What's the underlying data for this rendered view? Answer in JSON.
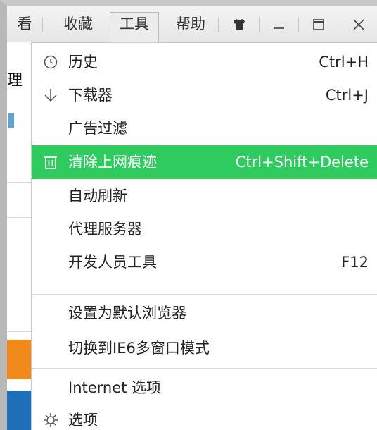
{
  "menubar": {
    "items": [
      {
        "label": "看"
      },
      {
        "label": "收藏"
      },
      {
        "label": "工具"
      },
      {
        "label": "帮助"
      }
    ],
    "window_buttons": [
      {
        "name": "skin",
        "icon": "shirt-icon"
      },
      {
        "name": "minimize",
        "icon": "minimize-icon"
      },
      {
        "name": "maximize",
        "icon": "maximize-icon"
      },
      {
        "name": "close",
        "icon": "close-icon"
      }
    ]
  },
  "background": {
    "left_text": "理"
  },
  "tools_menu": {
    "items": [
      {
        "label": "历史",
        "shortcut": "Ctrl+H",
        "icon": "clock-icon"
      },
      {
        "label": "下载器",
        "shortcut": "Ctrl+J",
        "icon": "download-arrow-icon"
      },
      {
        "label": "广告过滤",
        "shortcut": "",
        "icon": ""
      },
      {
        "label": "清除上网痕迹",
        "shortcut": "Ctrl+Shift+Delete",
        "icon": "trash-icon",
        "highlighted": true
      },
      {
        "label": "自动刷新",
        "shortcut": "",
        "icon": ""
      },
      {
        "label": "代理服务器",
        "shortcut": "",
        "icon": ""
      },
      {
        "label": "开发人员工具",
        "shortcut": "F12",
        "icon": ""
      },
      {
        "label": "设置为默认浏览器",
        "shortcut": "",
        "icon": ""
      },
      {
        "label": "切换到IE6多窗口模式",
        "shortcut": "",
        "icon": ""
      },
      {
        "label": "Internet 选项",
        "shortcut": "",
        "icon": ""
      },
      {
        "label": "选项",
        "shortcut": "",
        "icon": "gear-icon"
      }
    ]
  },
  "colors": {
    "highlight": "#2fcb5f",
    "accent_orange": "#f08a1c",
    "accent_blue": "#1e6fb8"
  }
}
